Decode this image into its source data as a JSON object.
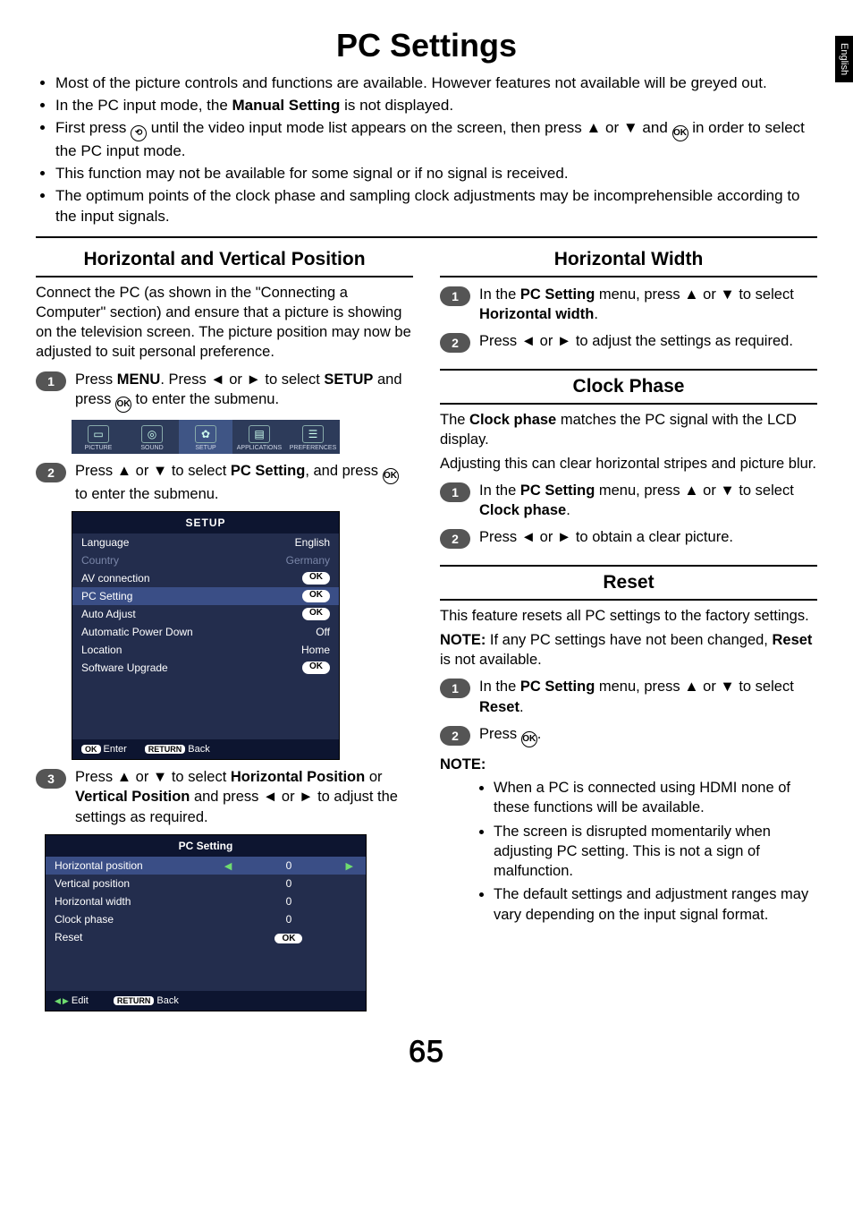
{
  "side_tab": "English",
  "page_title": "PC Settings",
  "intro_bullets": [
    "Most of the picture controls and functions are available. However features not available will be greyed out.",
    "In the PC input mode, the Manual Setting is not displayed.",
    "First press ⊕ until the video input mode list appears on the screen, then press ▲ or ▼ and ⊛ in order to select the PC input mode.",
    "This function may not be available for some signal or if no signal is received.",
    "The optimum points of the clock phase and sampling clock adjustments may be incomprehensible according to the input signals."
  ],
  "left": {
    "section_title": "Horizontal and Vertical Position",
    "lead": "Connect the PC (as shown in the \"Connecting a Computer\" section) and ensure that a picture is showing on the television screen. The picture position may now be adjusted to suit personal preference.",
    "step1_pre": "Press ",
    "step1_menu": "MENU",
    "step1_mid1": ". Press ◄ or ► to select ",
    "step1_setup": "SETUP",
    "step1_mid2": " and press ",
    "step1_post": " to enter  the submenu.",
    "ribbon": [
      "PICTURE",
      "SOUND",
      "SETUP",
      "APPLICATIONS",
      "PREFERENCES"
    ],
    "step2_pre": "Press ▲ or ▼ to select ",
    "step2_bold": "PC Setting",
    "step2_mid": ", and press ",
    "step2_post": " to enter the submenu.",
    "osd_setup": {
      "title": "SETUP",
      "rows": [
        {
          "l": "Language",
          "v": "English",
          "pill": false,
          "dim": false,
          "hl": false
        },
        {
          "l": "Country",
          "v": "Germany",
          "pill": false,
          "dim": true,
          "hl": false
        },
        {
          "l": "AV connection",
          "v": "OK",
          "pill": true,
          "dim": false,
          "hl": false
        },
        {
          "l": "PC Setting",
          "v": "OK",
          "pill": true,
          "dim": false,
          "hl": true
        },
        {
          "l": "Auto Adjust",
          "v": "OK",
          "pill": true,
          "dim": false,
          "hl": false
        },
        {
          "l": "Automatic Power Down",
          "v": "Off",
          "pill": false,
          "dim": false,
          "hl": false
        },
        {
          "l": "Location",
          "v": "Home",
          "pill": false,
          "dim": false,
          "hl": false
        },
        {
          "l": "Software Upgrade",
          "v": "OK",
          "pill": true,
          "dim": false,
          "hl": false
        }
      ],
      "footer": {
        "ok": "OK",
        "enter": "Enter",
        "ret": "RETURN",
        "back": "Back"
      }
    },
    "step3_pre": "Press ▲ or ▼ to select ",
    "step3_b1": "Horizontal Position",
    "step3_or": " or ",
    "step3_b2": "Vertical Position",
    "step3_post": " and press ◄ or ► to adjust the settings as required.",
    "osd_pc": {
      "title": "PC Setting",
      "rows": [
        {
          "l": "Horizontal position",
          "v": "0",
          "hl": true,
          "arrows": true,
          "pill": false
        },
        {
          "l": "Vertical position",
          "v": "0",
          "hl": false,
          "arrows": false,
          "pill": false
        },
        {
          "l": "Horizontal width",
          "v": "0",
          "hl": false,
          "arrows": false,
          "pill": false
        },
        {
          "l": "Clock phase",
          "v": "0",
          "hl": false,
          "arrows": false,
          "pill": false
        },
        {
          "l": "Reset",
          "v": "OK",
          "hl": false,
          "arrows": false,
          "pill": true
        }
      ],
      "footer": {
        "edit": "Edit",
        "ret": "RETURN",
        "back": "Back"
      }
    }
  },
  "right": {
    "hw_title": "Horizontal Width",
    "hw_s1_pre": "In the ",
    "hw_s1_b1": "PC Setting",
    "hw_s1_mid": " menu, press ▲ or ▼ to select ",
    "hw_s1_b2": "Horizontal width",
    "hw_s1_post": ".",
    "hw_s2": "Press ◄ or ► to adjust the settings as required.",
    "cp_title": "Clock Phase",
    "cp_p1_pre": "The ",
    "cp_p1_b": "Clock phase",
    "cp_p1_post": " matches the PC signal with the LCD display.",
    "cp_p2": "Adjusting this can clear horizontal stripes and picture blur.",
    "cp_s1_pre": "In the ",
    "cp_s1_b1": "PC Setting",
    "cp_s1_mid": " menu, press ▲ or ▼ to select ",
    "cp_s1_b2": "Clock phase",
    "cp_s1_post": ".",
    "cp_s2": "Press ◄ or ► to obtain a clear picture.",
    "rs_title": "Reset",
    "rs_p1": "This feature resets all PC settings to the factory settings.",
    "rs_note_label": "NOTE:",
    "rs_note_pre": " If any PC settings have not been changed, ",
    "rs_note_b": "Reset",
    "rs_note_post": " is not available.",
    "rs_s1_pre": "In the ",
    "rs_s1_b1": "PC Setting",
    "rs_s1_mid": " menu, press ▲ or ▼ to select ",
    "rs_s1_b2": "Reset",
    "rs_s1_post": ".",
    "rs_s2_pre": "Press ",
    "rs_s2_post": ".",
    "final_note_label": "NOTE:",
    "final_notes": [
      "When a PC is connected using HDMI none of these functions will be available.",
      "The screen is disrupted momentarily when adjusting PC setting. This is not a sign of malfunction.",
      "The default settings and adjustment ranges may vary depending on the input signal format."
    ]
  },
  "page_number": "65"
}
